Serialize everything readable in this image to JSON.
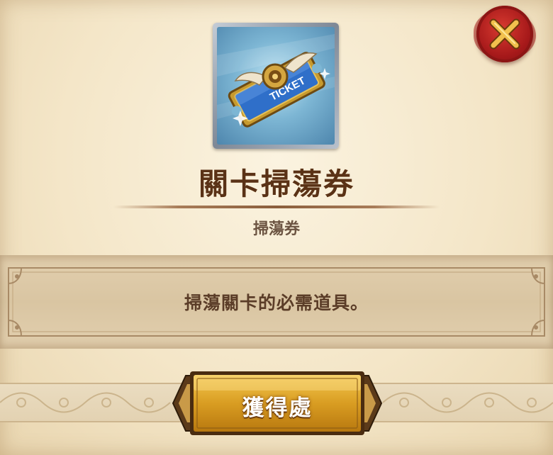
{
  "item": {
    "name": "關卡掃蕩券",
    "category": "掃蕩券",
    "description": "掃蕩關卡的必需道具。",
    "icon": "ticket-icon",
    "icon_text": "TICKET"
  },
  "actions": {
    "source_label": "獲得處",
    "close_icon": "close-icon"
  },
  "colors": {
    "title": "#5a3216",
    "button_gold": "#d9a028",
    "close_red": "#b01f1e",
    "parchment": "#f4e6c8"
  }
}
